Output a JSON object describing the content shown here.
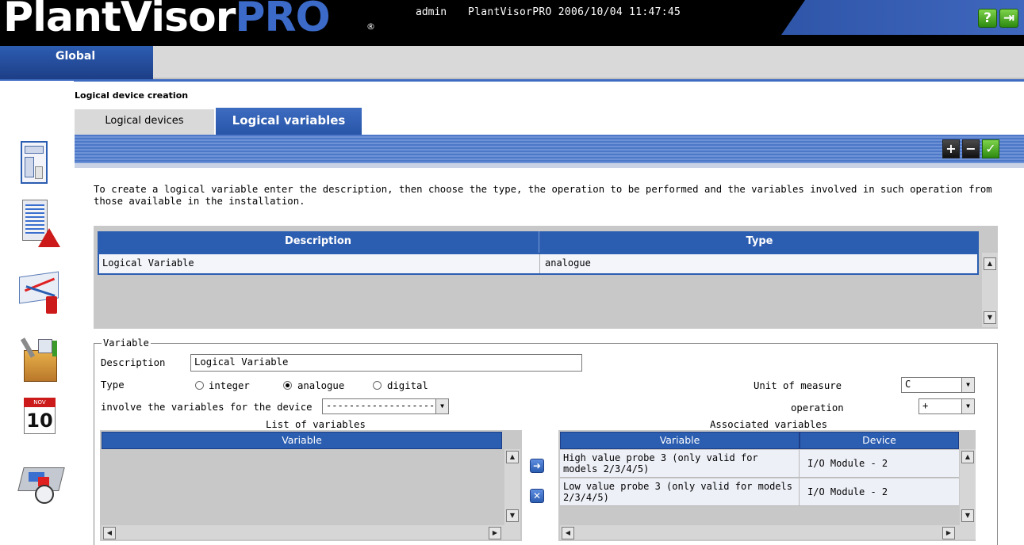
{
  "header": {
    "logo_plant": "PlantVisor",
    "logo_pro": "PRO",
    "logo_reg": "®",
    "user": "admin",
    "info": "PlantVisorPRO  2006/10/04  11:47:45",
    "help_label": "?",
    "exit_label": "⇥"
  },
  "nav": {
    "global_label": "Global"
  },
  "page": {
    "section_title": "Logical device creation",
    "tabs": [
      {
        "label": "Logical devices"
      },
      {
        "label": "Logical variables"
      }
    ],
    "toolbar": {
      "add": "+",
      "remove": "−",
      "confirm": "✓"
    },
    "instructions": "To create a logical variable enter the description, then choose the type, the operation to be performed and the variables involved in such operation from those available in the installation."
  },
  "var_table": {
    "columns": [
      "Description",
      "Type"
    ],
    "rows": [
      {
        "description": "Logical Variable",
        "type": "analogue"
      }
    ]
  },
  "variable_form": {
    "legend": "Variable",
    "description_label": "Description",
    "description_value": "Logical Variable",
    "type_label": "Type",
    "type_options": [
      "integer",
      "analogue",
      "digital"
    ],
    "type_selected": "analogue",
    "unit_label": "Unit of measure",
    "unit_value": "C",
    "involve_label": "involve the variables for the device",
    "device_select_value": "---------------------",
    "operation_label": "operation",
    "operation_value": "+"
  },
  "list_of_variables": {
    "title": "List of variables",
    "columns": [
      "Variable"
    ],
    "rows": []
  },
  "associated_variables": {
    "title": "Associated variables",
    "columns": [
      "Variable",
      "Device"
    ],
    "rows": [
      {
        "variable": "High value probe 3 (only valid for models 2/3/4/5)",
        "device": "I/O Module - 2"
      },
      {
        "variable": "Low value probe 3 (only valid for models 2/3/4/5)",
        "device": "I/O Module - 2"
      }
    ]
  },
  "icons": {
    "sidebar": [
      "site-layout-icon",
      "alarm-report-icon",
      "graph-icon",
      "tools-box-icon",
      "calendar-icon",
      "plant-scheduler-icon"
    ],
    "calendar_month": "NOV",
    "calendar_day": "10"
  },
  "colors": {
    "accent": "#2b5db0",
    "logo_pro": "#3b6ac8",
    "confirm_green": "#2d8a10"
  }
}
